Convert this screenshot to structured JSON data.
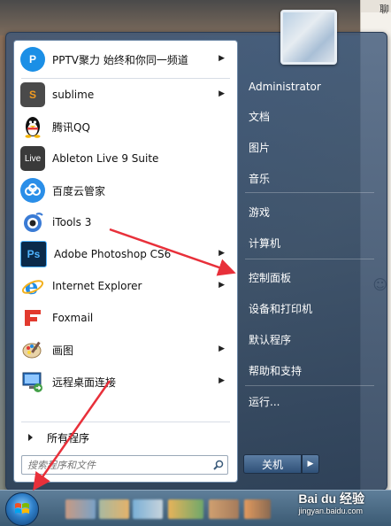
{
  "programs": [
    {
      "label": "PPTV聚力 始终和你同一频道",
      "icon": "pptv-icon",
      "has_submenu": true
    },
    {
      "label": "sublime",
      "icon": "sublime-icon",
      "has_submenu": true
    },
    {
      "label": "腾讯QQ",
      "icon": "qq-penguin-icon",
      "has_submenu": false
    },
    {
      "label": "Ableton Live 9 Suite",
      "icon": "ableton-live-icon",
      "has_submenu": false
    },
    {
      "label": "百度云管家",
      "icon": "baidu-cloud-icon",
      "has_submenu": false
    },
    {
      "label": "iTools 3",
      "icon": "itools-icon",
      "has_submenu": false
    },
    {
      "label": "Adobe Photoshop CS6",
      "icon": "photoshop-icon",
      "has_submenu": true
    },
    {
      "label": "Internet Explorer",
      "icon": "internet-explorer-icon",
      "has_submenu": true
    },
    {
      "label": "Foxmail",
      "icon": "foxmail-icon",
      "has_submenu": false
    },
    {
      "label": "画图",
      "icon": "paint-icon",
      "has_submenu": true
    },
    {
      "label": "远程桌面连接",
      "icon": "remote-desktop-icon",
      "has_submenu": true
    }
  ],
  "all_programs_label": "所有程序",
  "search": {
    "placeholder": "搜索程序和文件"
  },
  "right_items": [
    {
      "label": "Administrator"
    },
    {
      "label": "文档"
    },
    {
      "label": "图片"
    },
    {
      "label": "音乐"
    },
    {
      "label": "游戏"
    },
    {
      "label": "计算机"
    },
    {
      "label": "控制面板"
    },
    {
      "label": "设备和打印机"
    },
    {
      "label": "默认程序"
    },
    {
      "label": "帮助和支持"
    },
    {
      "label": "运行..."
    }
  ],
  "shutdown_label": "关机",
  "watermark": {
    "brand": "Bai du 经验",
    "url": "jingyan.baidu.com"
  },
  "desk_label": "聊",
  "colors": {
    "arrow": "#e8303a",
    "accent": "#2f7fc8"
  }
}
